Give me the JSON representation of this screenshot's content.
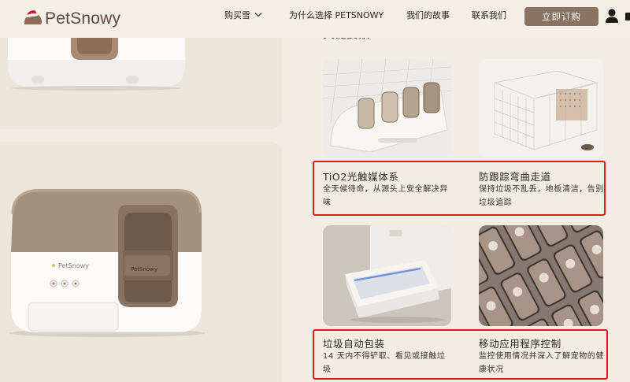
{
  "header": {
    "logo_text": "PetSnowy",
    "nav": [
      {
        "label": "购买雪"
      },
      {
        "label": "为什么选择 PETSNOWY"
      },
      {
        "label": "我们的故事"
      },
      {
        "label": "联系我们"
      }
    ],
    "cta_label": "立即订购"
  },
  "product": {
    "badge_text": "PetSnowy",
    "door_text": "PetSnowy"
  },
  "section": {
    "title": "关键要素"
  },
  "features": [
    {
      "title": "TiO2光触媒体系",
      "desc": "全天候待命，从源头上安全解决异味"
    },
    {
      "title": "防跟踪弯曲走道",
      "desc": "保持垃圾不乱丢，地板清洁，告别垃圾追踪"
    },
    {
      "title": "垃圾自动包装",
      "desc": "14 天内不得铲取、看见或接触垃圾"
    },
    {
      "title": "移动应用程序控制",
      "desc": "监控使用情况并深入了解宠物的健康状况"
    }
  ],
  "colors": {
    "page_bg": "#f2ede4",
    "card_bg": "#ebe5da",
    "accent": "#8a7361",
    "highlight": "#e01b1b"
  },
  "icons": [
    "santa-hat-logo-icon",
    "chevron-down-icon",
    "user-icon"
  ]
}
